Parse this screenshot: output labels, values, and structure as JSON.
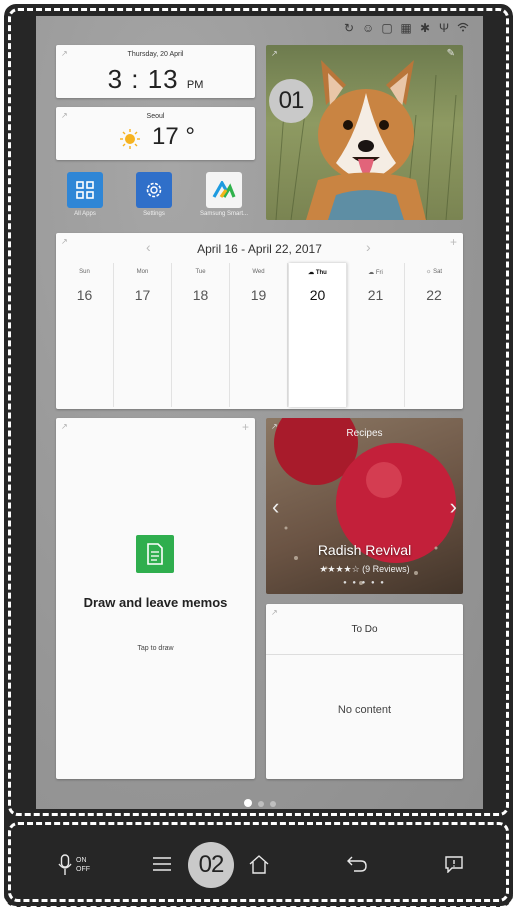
{
  "status_icons": [
    "sync-icon",
    "user-icon",
    "chat-icon",
    "sim-icon",
    "bluetooth-icon",
    "usb-icon",
    "wifi-icon"
  ],
  "clock": {
    "date": "Thursday, 20 April",
    "time": "3 : 13",
    "ampm": "PM"
  },
  "weather": {
    "city": "Seoul",
    "temp": "17 °"
  },
  "apps": [
    {
      "label": "All Apps"
    },
    {
      "label": "Settings"
    },
    {
      "label": "Samsung Smart..."
    }
  ],
  "callouts": {
    "photo": "01",
    "nav": "02"
  },
  "calendar": {
    "range": "April 16 - April 22, 2017",
    "days": [
      {
        "name": "Sun",
        "num": "16"
      },
      {
        "name": "Mon",
        "num": "17"
      },
      {
        "name": "Tue",
        "num": "18"
      },
      {
        "name": "Wed",
        "num": "19"
      },
      {
        "name": "Thu",
        "num": "20"
      },
      {
        "name": "Fri",
        "num": "21"
      },
      {
        "name": "Sat",
        "num": "22"
      }
    ],
    "active_day": "Thu"
  },
  "memo": {
    "heading": "Draw and leave memos",
    "sub": "Tap to draw"
  },
  "recipes": {
    "title": "Recipes",
    "name": "Radish Revival",
    "reviews": "(9 Reviews)",
    "stars": "★★★★☆"
  },
  "todo": {
    "title": "To Do",
    "empty": "No content"
  },
  "navbar": {
    "voice_on": "ON",
    "voice_off": "OFF"
  },
  "colors": {
    "memo_green": "#2fae4e",
    "apps_blue": "#2f86d6"
  }
}
